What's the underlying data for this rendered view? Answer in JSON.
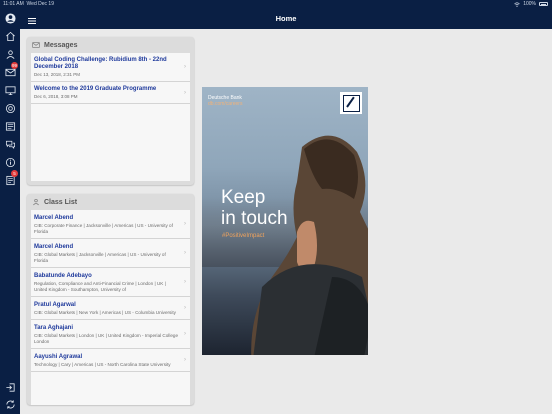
{
  "status_bar": {
    "time": "11:01 AM",
    "date": "Wed Dec 19",
    "wifi_icon": "wifi-icon",
    "battery_text": "100%",
    "battery_icon": "battery-icon"
  },
  "header": {
    "title": "Home",
    "menu_icon": "hamburger-menu-icon"
  },
  "sidebar": {
    "items": [
      {
        "name": "profile",
        "icon": "user-avatar-icon"
      },
      {
        "name": "home",
        "icon": "home-icon"
      },
      {
        "name": "contacts",
        "icon": "contacts-icon"
      },
      {
        "name": "messages",
        "icon": "envelope-icon",
        "badge": "99"
      },
      {
        "name": "presentation",
        "icon": "monitor-icon"
      },
      {
        "name": "web",
        "icon": "globe-icon"
      },
      {
        "name": "news",
        "icon": "newspaper-icon"
      },
      {
        "name": "chat",
        "icon": "chat-bubbles-icon"
      },
      {
        "name": "info",
        "icon": "info-icon"
      },
      {
        "name": "tasks",
        "icon": "checklist-icon",
        "badge": "5"
      },
      {
        "name": "logout",
        "icon": "logout-icon"
      },
      {
        "name": "sync",
        "icon": "sync-icon"
      }
    ]
  },
  "messages": {
    "title": "Messages",
    "icon": "envelope-icon",
    "items": [
      {
        "title": "Global Coding Challenge: Rubidium 8th - 22nd December 2018",
        "date": "Dec 13, 2018, 2:31 PM"
      },
      {
        "title": "Welcome to the 2019 Graduate Programme",
        "date": "Dec 6, 2018, 3:08 PM"
      }
    ]
  },
  "class_list": {
    "title": "Class List",
    "icon": "person-icon",
    "items": [
      {
        "name": "Marcel Abend",
        "detail": "CIB: Corporate Finance | Jacksonville | Americas | US - University of Florida"
      },
      {
        "name": "Marcel Abend",
        "detail": "CIB: Global Markets | Jacksonville | Americas | US - University of Florida"
      },
      {
        "name": "Babatunde Adebayo",
        "detail": "Regulation, Compliance and Anti-Financial Crime | London | UK | United Kingdom - Southampton, University of"
      },
      {
        "name": "Pratul Agarwal",
        "detail": "CIB: Global Markets | New York | Americas | US - Columbia University"
      },
      {
        "name": "Tara Aghajani",
        "detail": "CIB: Global Markets | London | UK | United Kingdom - Imperial College London"
      },
      {
        "name": "Aayushi Agrawal",
        "detail": "Technology | Cary | Americas | US - North Carolina State University"
      }
    ]
  },
  "ad": {
    "brand": "Deutsche Bank",
    "url": "db.com/careers",
    "headline_line1": "Keep",
    "headline_line2": "in touch",
    "hashtag": "#PositiveImpact",
    "logo_icon": "deutsche-bank-logo"
  }
}
